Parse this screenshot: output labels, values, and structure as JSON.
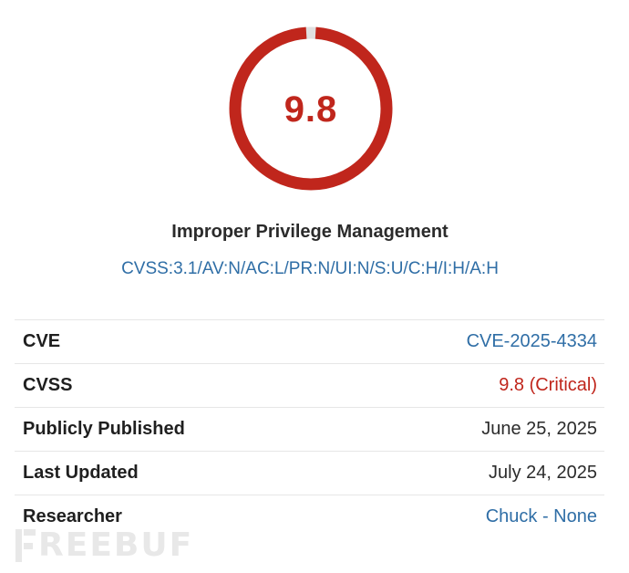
{
  "score": {
    "value": "9.8",
    "fraction": 0.98,
    "ring_color": "#c0261c",
    "track_color": "#e0e0e0"
  },
  "vulnerability": {
    "title": "Improper Privilege Management",
    "vector": "CVSS:3.1/AV:N/AC:L/PR:N/UI:N/S:U/C:H/I:H/A:H"
  },
  "colors": {
    "link": "#2f6ea6",
    "critical": "#c0261c"
  },
  "details": {
    "cve": {
      "label": "CVE",
      "value": "CVE-2025-4334"
    },
    "cvss": {
      "label": "CVSS",
      "value": "9.8 (Critical)"
    },
    "published": {
      "label": "Publicly Published",
      "value": "June 25, 2025"
    },
    "updated": {
      "label": "Last Updated",
      "value": "July 24, 2025"
    },
    "researcher": {
      "label": "Researcher",
      "value": "Chuck - None"
    }
  },
  "watermark": {
    "text": "REEBUF"
  }
}
